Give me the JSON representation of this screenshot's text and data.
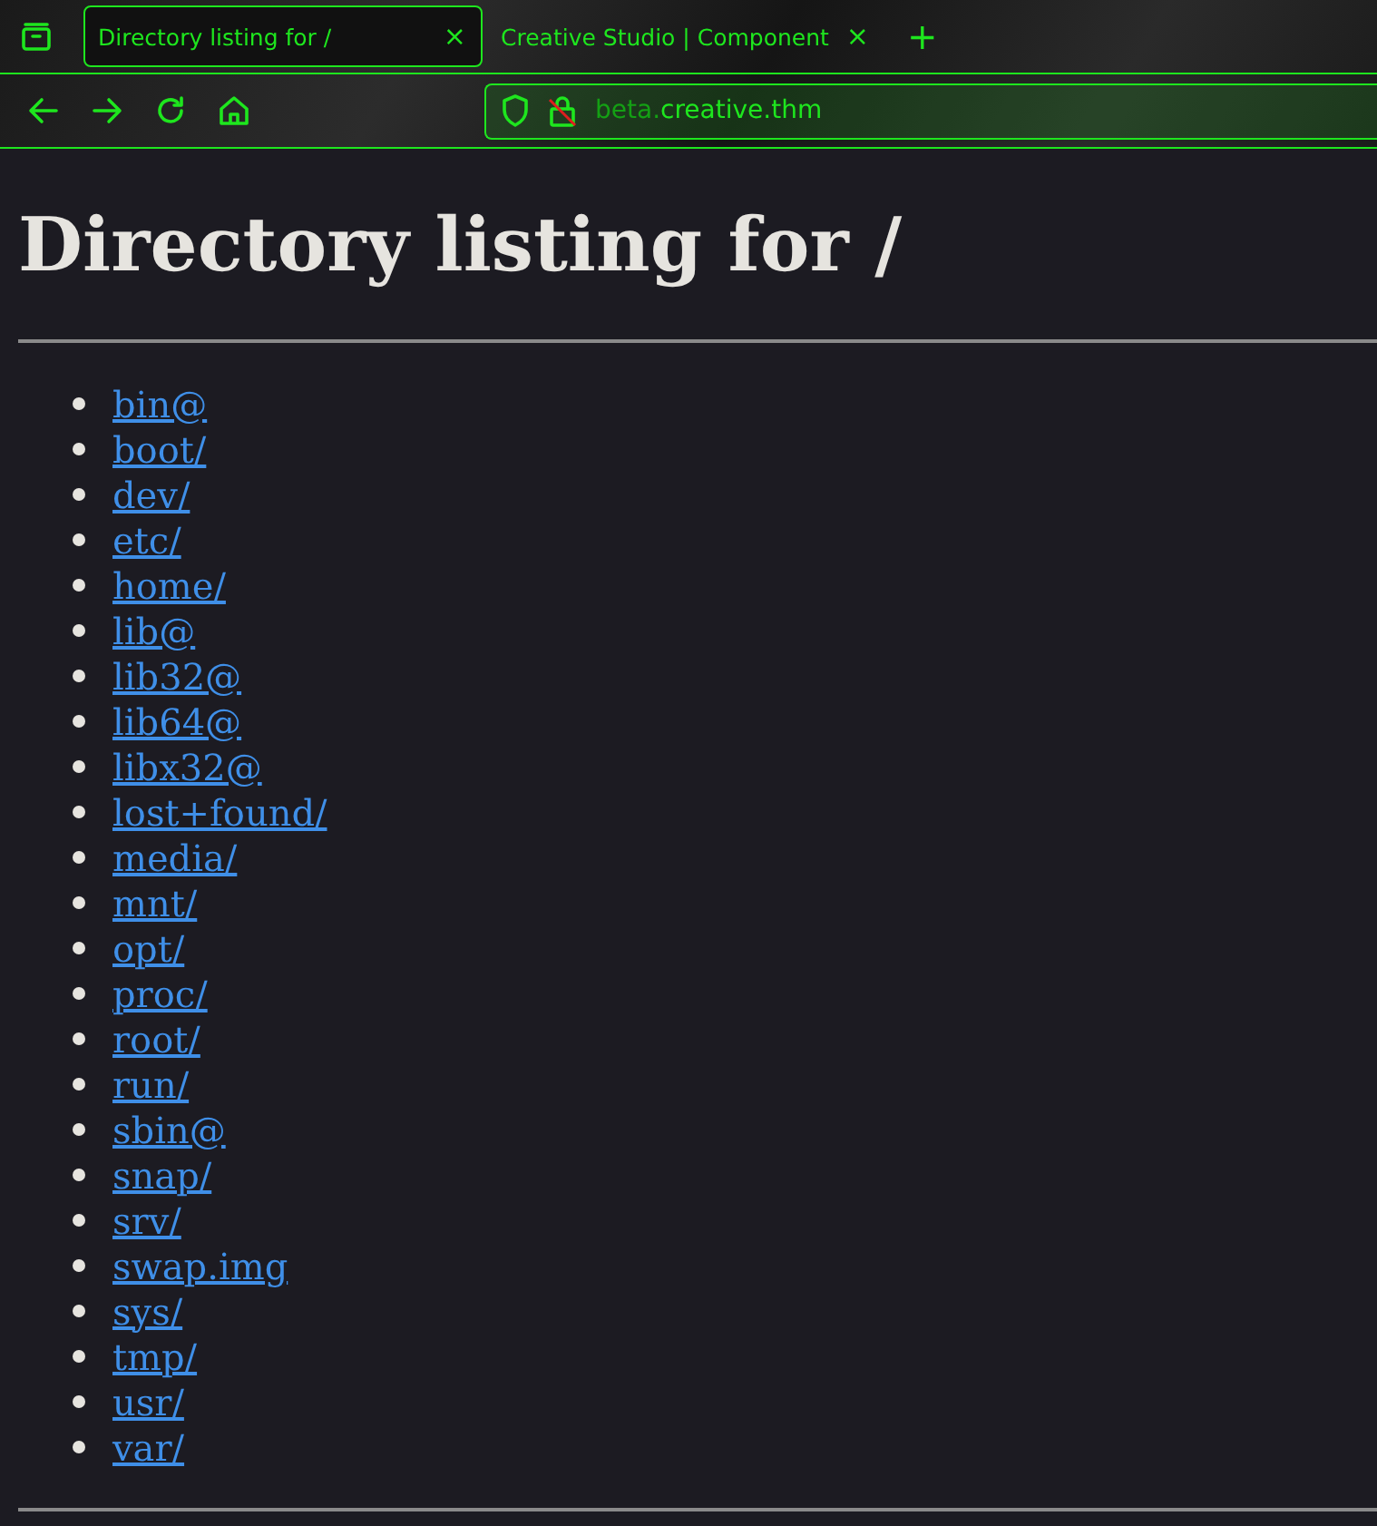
{
  "browser": {
    "tabs": [
      {
        "title": "Directory listing for /",
        "close": "×",
        "selected": true
      },
      {
        "title": "Creative Studio | Component",
        "close": "×",
        "selected": false
      }
    ],
    "new_tab": "+",
    "address": {
      "host_prefix": "beta.",
      "host_domain": "creative.thm"
    }
  },
  "page": {
    "heading": "Directory listing for /",
    "entries": [
      "bin@",
      "boot/",
      "dev/",
      "etc/",
      "home/",
      "lib@",
      "lib32@",
      "lib64@",
      "libx32@",
      "lost+found/",
      "media/",
      "mnt/",
      "opt/",
      "proc/",
      "root/",
      "run/",
      "sbin@",
      "snap/",
      "srv/",
      "swap.img",
      "sys/",
      "tmp/",
      "usr/",
      "var/"
    ]
  }
}
